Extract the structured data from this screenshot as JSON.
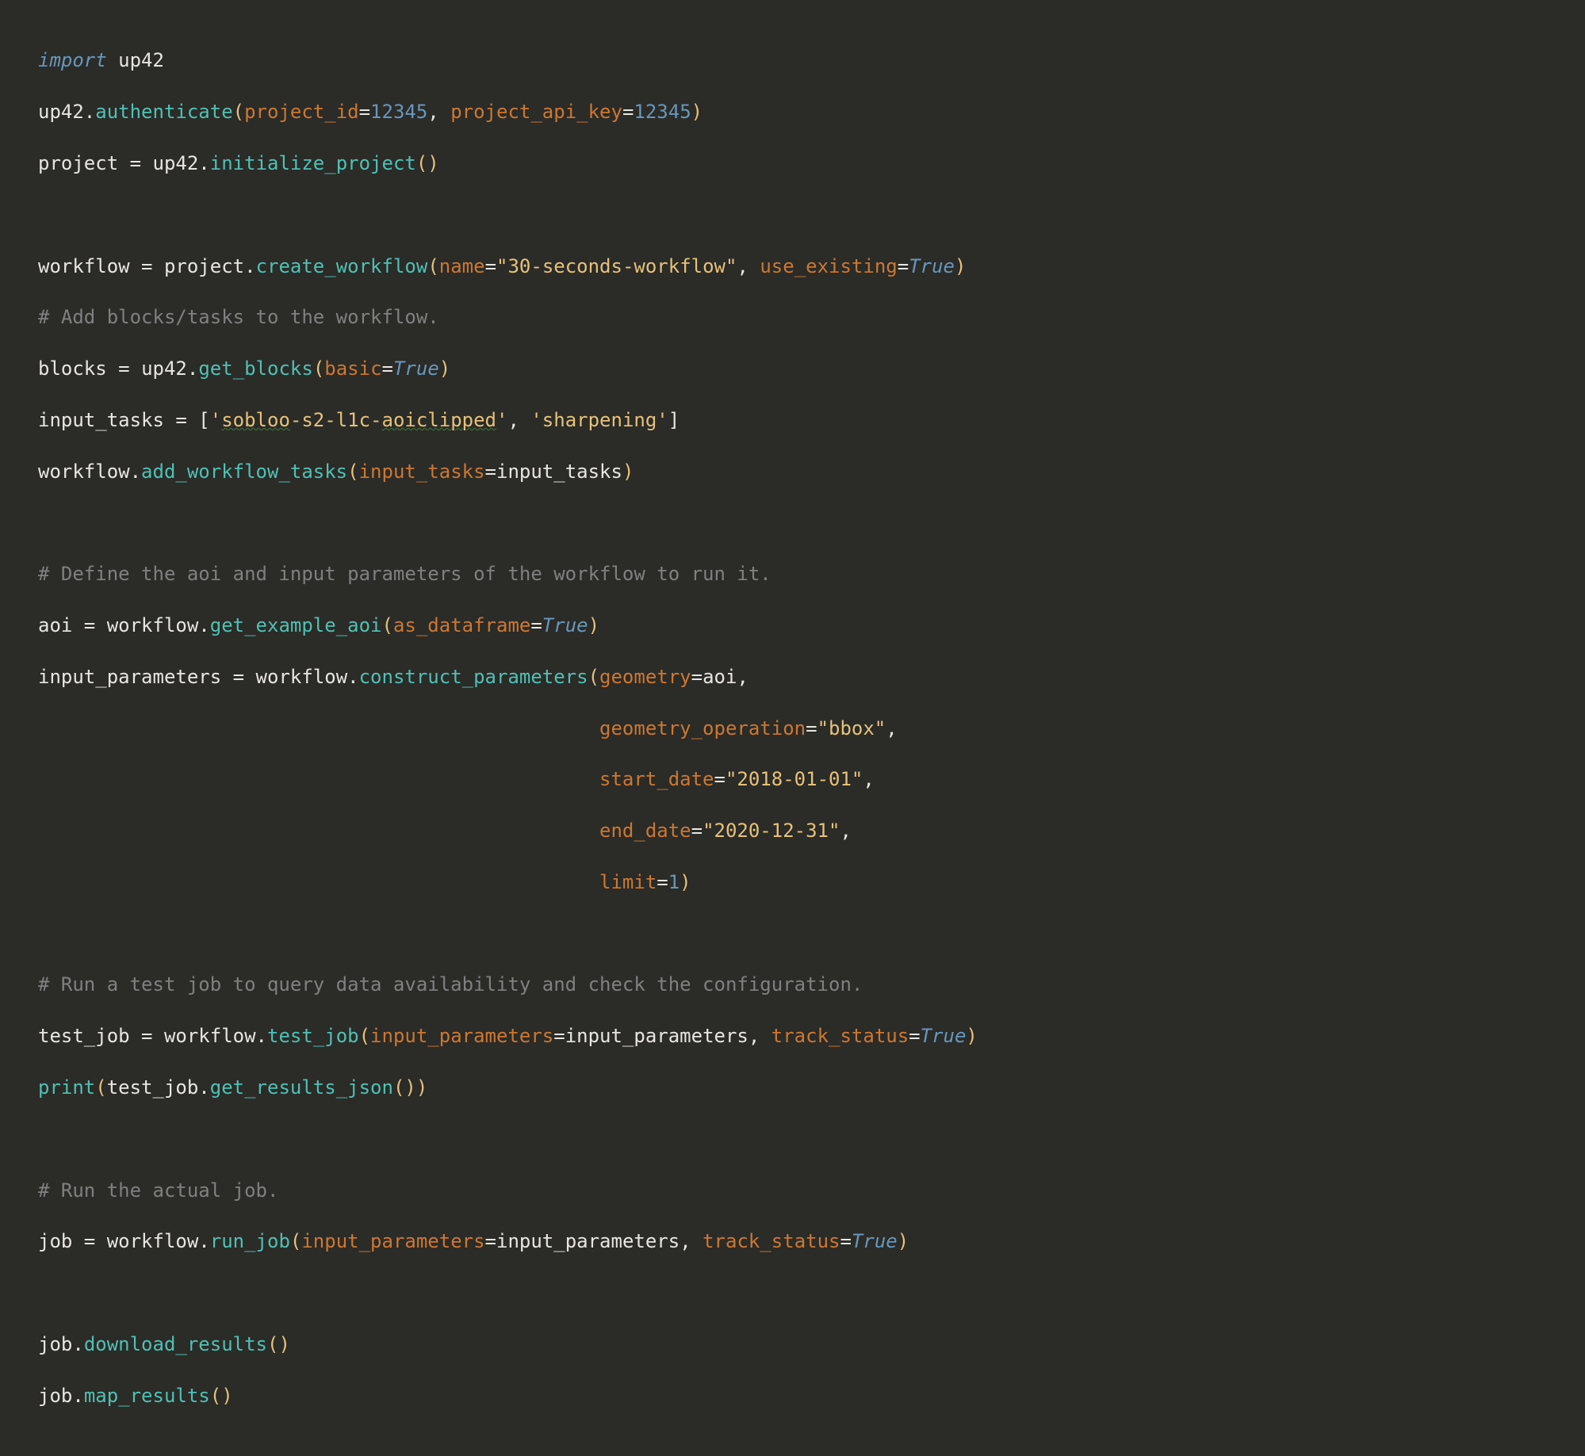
{
  "code": {
    "l1": {
      "import": "import",
      "sp": " ",
      "mod": "up42"
    },
    "l2": {
      "obj": "up42",
      "dot": ".",
      "fn": "authenticate",
      "lp": "(",
      "p1": "project_id",
      "eq1": "=",
      "v1": "12345",
      "c1": ", ",
      "p2": "project_api_key",
      "eq2": "=",
      "v2": "12345",
      "rp": ")"
    },
    "l3": {
      "lhs": "project ",
      "eq": "= ",
      "obj": "up42",
      "dot": ".",
      "fn": "initialize_project",
      "lp": "(",
      "rp": ")"
    },
    "l4": {
      "blank": ""
    },
    "l5": {
      "lhs": "workflow ",
      "eq": "= ",
      "obj": "project",
      "dot": ".",
      "fn": "create_workflow",
      "lp": "(",
      "p1": "name",
      "eq1": "=",
      "v1": "\"30-seconds-workflow\"",
      "c1": ", ",
      "p2": "use_existing",
      "eq2": "=",
      "v2": "True",
      "rp": ")"
    },
    "l6": {
      "comment": "# Add blocks/tasks to the workflow."
    },
    "l7": {
      "lhs": "blocks ",
      "eq": "= ",
      "obj": "up42",
      "dot": ".",
      "fn": "get_blocks",
      "lp": "(",
      "p1": "basic",
      "eq1": "=",
      "v1": "True",
      "rp": ")"
    },
    "l8": {
      "lhs": "input_tasks ",
      "eq": "= ",
      "lb": "[",
      "q1a": "'",
      "s1a": "sobloo",
      "s1b": "-s2-l1c-",
      "s1c": "aoiclipped",
      "q1b": "'",
      "c1": ", ",
      "s2": "'sharpening'",
      "rb": "]"
    },
    "l9": {
      "obj": "workflow",
      "dot": ".",
      "fn": "add_workflow_tasks",
      "lp": "(",
      "p1": "input_tasks",
      "eq1": "=",
      "v1": "input_tasks",
      "rp": ")"
    },
    "l10": {
      "blank": ""
    },
    "l11": {
      "comment": "# Define the aoi and input parameters of the workflow to run it."
    },
    "l12": {
      "lhs": "aoi ",
      "eq": "= ",
      "obj": "workflow",
      "dot": ".",
      "fn": "get_example_aoi",
      "lp": "(",
      "p1": "as_dataframe",
      "eq1": "=",
      "v1": "True",
      "rp": ")"
    },
    "l13": {
      "lhs": "input_parameters ",
      "eq": "= ",
      "obj": "workflow",
      "dot": ".",
      "fn": "construct_parameters",
      "lp": "(",
      "p1": "geometry",
      "eq1": "=",
      "v1": "aoi",
      "c1": ","
    },
    "l14": {
      "pad": "                                                 ",
      "p": "geometry_operation",
      "eq": "=",
      "v": "\"bbox\"",
      "c": ","
    },
    "l15": {
      "pad": "                                                 ",
      "p": "start_date",
      "eq": "=",
      "v": "\"2018-01-01\"",
      "c": ","
    },
    "l16": {
      "pad": "                                                 ",
      "p": "end_date",
      "eq": "=",
      "v": "\"2020-12-31\"",
      "c": ","
    },
    "l17": {
      "pad": "                                                 ",
      "p": "limit",
      "eq": "=",
      "v": "1",
      "rp": ")"
    },
    "l18": {
      "blank": ""
    },
    "l19": {
      "comment": "# Run a test job to query data availability and check the configuration."
    },
    "l20": {
      "lhs": "test_job ",
      "eq": "= ",
      "obj": "workflow",
      "dot": ".",
      "fn": "test_job",
      "lp": "(",
      "p1": "input_parameters",
      "eq1": "=",
      "v1": "input_parameters",
      "c1": ", ",
      "p2": "track_status",
      "eq2": "=",
      "v2": "True",
      "rp": ")"
    },
    "l21": {
      "fn0": "print",
      "lp0": "(",
      "obj": "test_job",
      "dot": ".",
      "fn": "get_results_json",
      "lp": "(",
      "rp": ")",
      "rp0": ")"
    },
    "l22": {
      "blank": ""
    },
    "l23": {
      "comment": "# Run the actual job."
    },
    "l24": {
      "lhs": "job ",
      "eq": "= ",
      "obj": "workflow",
      "dot": ".",
      "fn": "run_job",
      "lp": "(",
      "p1": "input_parameters",
      "eq1": "=",
      "v1": "input_parameters",
      "c1": ", ",
      "p2": "track_status",
      "eq2": "=",
      "v2": "True",
      "rp": ")"
    },
    "l25": {
      "blank": ""
    },
    "l26": {
      "obj": "job",
      "dot": ".",
      "fn": "download_results",
      "lp": "(",
      "rp": ")"
    },
    "l27": {
      "obj": "job",
      "dot": ".",
      "fn": "map_results",
      "lp": "(",
      "rp": ")"
    }
  }
}
